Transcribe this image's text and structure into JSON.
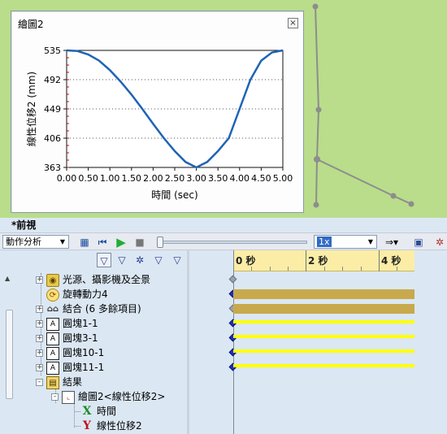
{
  "viewport": {
    "label": "*前視",
    "colors": {
      "background": "#b9dd8b",
      "sketch_line": "#8d8d8d"
    }
  },
  "chart_window": {
    "title": "繪圖2",
    "close_icon": "close-icon"
  },
  "chart_data": {
    "type": "line",
    "title": "",
    "xlabel": "時間 (sec)",
    "ylabel": "線性位移2 (mm)",
    "xlim": [
      0,
      5
    ],
    "ylim": [
      363,
      535
    ],
    "xticks": [
      "0.00",
      "0.50",
      "1.00",
      "1.50",
      "2.00",
      "2.50",
      "3.00",
      "3.50",
      "4.00",
      "4.50",
      "5.00"
    ],
    "yticks": [
      "363",
      "406",
      "449",
      "492",
      "535"
    ],
    "series": [
      {
        "color": "#1f63b5",
        "x": [
          0.0,
          0.25,
          0.5,
          0.75,
          1.0,
          1.25,
          1.5,
          1.75,
          2.0,
          2.25,
          2.5,
          2.75,
          3.0,
          3.25,
          3.5,
          3.75,
          4.0,
          4.25,
          4.5,
          4.75,
          5.0
        ],
        "y": [
          535,
          534,
          529,
          520,
          506,
          489,
          470,
          449,
          427,
          406,
          387,
          371,
          363,
          371,
          387,
          406,
          449,
          492,
          520,
          532,
          535
        ]
      }
    ]
  },
  "toolbar": {
    "study_type": "動作分析",
    "playback_speed": "1x",
    "icons": [
      "calculate-icon",
      "play-from-start-icon",
      "play-icon",
      "stop-icon",
      "playback-mode-icon",
      "save-icon",
      "settings-icon"
    ]
  },
  "tree": {
    "filter_icons": [
      "filter-animated-icon",
      "filter-driving-icon",
      "filter-selected-icon",
      "filter-results-icon",
      "filter-all-icon"
    ],
    "items": [
      {
        "label": "光源、攝影機及全景",
        "icon": "lights-folder-icon",
        "expander": "+"
      },
      {
        "label": "旋轉動力4",
        "icon": "rotary-motor-icon",
        "expander": ""
      },
      {
        "label": "結合 (6 多餘項目)",
        "icon": "mates-icon",
        "expander": "+"
      },
      {
        "label": "圓塊1-1",
        "icon": "part-icon",
        "expander": "+"
      },
      {
        "label": "圓塊3-1",
        "icon": "part-icon",
        "expander": "+"
      },
      {
        "label": "圓塊10-1",
        "icon": "part-icon",
        "expander": "+"
      },
      {
        "label": "圓塊11-1",
        "icon": "part-icon",
        "expander": "+"
      },
      {
        "label": "結果",
        "icon": "results-folder-icon",
        "expander": "-"
      },
      {
        "label": "繪圖2<線性位移2>",
        "icon": "plot-icon",
        "expander": "-"
      },
      {
        "label": "時間",
        "icon": "x-axis-icon",
        "expander": ""
      },
      {
        "label": "線性位移2",
        "icon": "y-axis-icon",
        "expander": ""
      }
    ]
  },
  "timeline": {
    "ruler_labels": [
      "0 秒",
      "2 秒",
      "4 秒"
    ],
    "colors": {
      "motor_bar": "#c8a94c",
      "part_bar": "#ffff00",
      "key": "#1c2fbf",
      "ruler": "#fbeda6"
    }
  }
}
